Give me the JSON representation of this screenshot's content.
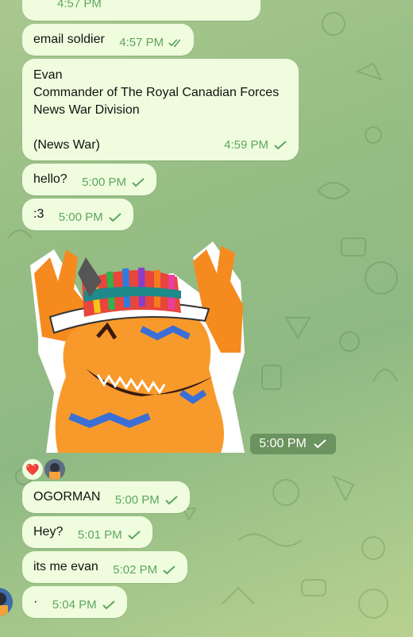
{
  "messages": [
    {
      "text": "",
      "time": "4:57 PM",
      "status": "read"
    },
    {
      "text": "email soldier",
      "time": "4:57 PM",
      "status": "read"
    },
    {
      "text": "Evan\nCommander of The Royal Canadian Forces\nNews War Division\n\n(News War)",
      "time": "4:59 PM",
      "status": "sent"
    },
    {
      "text": "hello?",
      "time": "5:00 PM",
      "status": "sent"
    },
    {
      "text": ":3",
      "time": "5:00 PM",
      "status": "sent"
    },
    {
      "text": "OGORMAN",
      "time": "5:00 PM",
      "status": "sent"
    },
    {
      "text": "Hey?",
      "time": "5:01 PM",
      "status": "sent"
    },
    {
      "text": "its me evan",
      "time": "5:02 PM",
      "status": "sent"
    },
    {
      "text": "·",
      "time": "5:04 PM",
      "status": "sent"
    }
  ],
  "sticker": {
    "time": "5:00 PM",
    "status": "sent",
    "description_icon": "dinosaur-rainbow-hat-sticker"
  },
  "reactions": [
    {
      "emoji": "❤️"
    }
  ],
  "colors": {
    "bubble": "#effdde",
    "meta": "#5fa460",
    "background": "#9cc388"
  }
}
